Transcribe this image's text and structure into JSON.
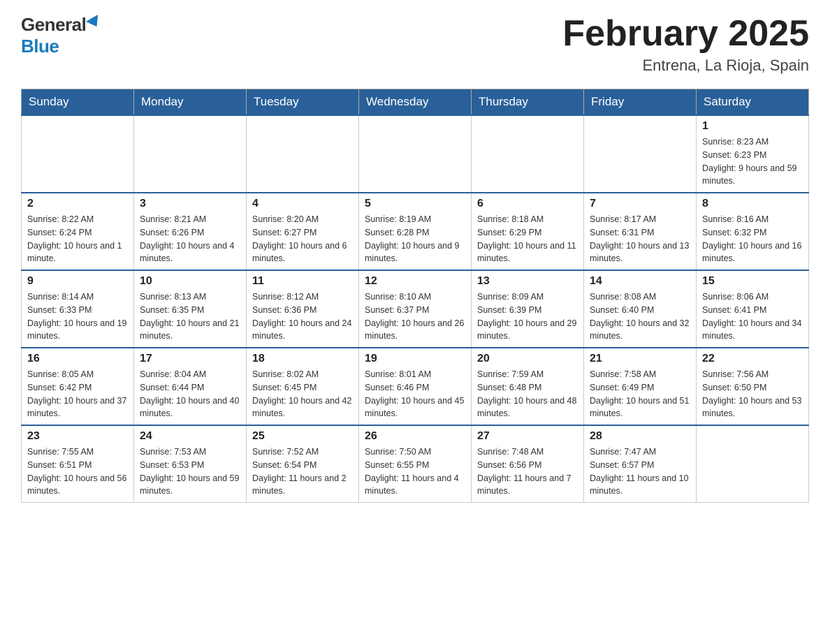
{
  "header": {
    "logo_general": "General",
    "logo_blue": "Blue",
    "month_title": "February 2025",
    "location": "Entrena, La Rioja, Spain"
  },
  "days_of_week": [
    "Sunday",
    "Monday",
    "Tuesday",
    "Wednesday",
    "Thursday",
    "Friday",
    "Saturday"
  ],
  "weeks": [
    [
      {
        "day": "",
        "info": ""
      },
      {
        "day": "",
        "info": ""
      },
      {
        "day": "",
        "info": ""
      },
      {
        "day": "",
        "info": ""
      },
      {
        "day": "",
        "info": ""
      },
      {
        "day": "",
        "info": ""
      },
      {
        "day": "1",
        "info": "Sunrise: 8:23 AM\nSunset: 6:23 PM\nDaylight: 9 hours and 59 minutes."
      }
    ],
    [
      {
        "day": "2",
        "info": "Sunrise: 8:22 AM\nSunset: 6:24 PM\nDaylight: 10 hours and 1 minute."
      },
      {
        "day": "3",
        "info": "Sunrise: 8:21 AM\nSunset: 6:26 PM\nDaylight: 10 hours and 4 minutes."
      },
      {
        "day": "4",
        "info": "Sunrise: 8:20 AM\nSunset: 6:27 PM\nDaylight: 10 hours and 6 minutes."
      },
      {
        "day": "5",
        "info": "Sunrise: 8:19 AM\nSunset: 6:28 PM\nDaylight: 10 hours and 9 minutes."
      },
      {
        "day": "6",
        "info": "Sunrise: 8:18 AM\nSunset: 6:29 PM\nDaylight: 10 hours and 11 minutes."
      },
      {
        "day": "7",
        "info": "Sunrise: 8:17 AM\nSunset: 6:31 PM\nDaylight: 10 hours and 13 minutes."
      },
      {
        "day": "8",
        "info": "Sunrise: 8:16 AM\nSunset: 6:32 PM\nDaylight: 10 hours and 16 minutes."
      }
    ],
    [
      {
        "day": "9",
        "info": "Sunrise: 8:14 AM\nSunset: 6:33 PM\nDaylight: 10 hours and 19 minutes."
      },
      {
        "day": "10",
        "info": "Sunrise: 8:13 AM\nSunset: 6:35 PM\nDaylight: 10 hours and 21 minutes."
      },
      {
        "day": "11",
        "info": "Sunrise: 8:12 AM\nSunset: 6:36 PM\nDaylight: 10 hours and 24 minutes."
      },
      {
        "day": "12",
        "info": "Sunrise: 8:10 AM\nSunset: 6:37 PM\nDaylight: 10 hours and 26 minutes."
      },
      {
        "day": "13",
        "info": "Sunrise: 8:09 AM\nSunset: 6:39 PM\nDaylight: 10 hours and 29 minutes."
      },
      {
        "day": "14",
        "info": "Sunrise: 8:08 AM\nSunset: 6:40 PM\nDaylight: 10 hours and 32 minutes."
      },
      {
        "day": "15",
        "info": "Sunrise: 8:06 AM\nSunset: 6:41 PM\nDaylight: 10 hours and 34 minutes."
      }
    ],
    [
      {
        "day": "16",
        "info": "Sunrise: 8:05 AM\nSunset: 6:42 PM\nDaylight: 10 hours and 37 minutes."
      },
      {
        "day": "17",
        "info": "Sunrise: 8:04 AM\nSunset: 6:44 PM\nDaylight: 10 hours and 40 minutes."
      },
      {
        "day": "18",
        "info": "Sunrise: 8:02 AM\nSunset: 6:45 PM\nDaylight: 10 hours and 42 minutes."
      },
      {
        "day": "19",
        "info": "Sunrise: 8:01 AM\nSunset: 6:46 PM\nDaylight: 10 hours and 45 minutes."
      },
      {
        "day": "20",
        "info": "Sunrise: 7:59 AM\nSunset: 6:48 PM\nDaylight: 10 hours and 48 minutes."
      },
      {
        "day": "21",
        "info": "Sunrise: 7:58 AM\nSunset: 6:49 PM\nDaylight: 10 hours and 51 minutes."
      },
      {
        "day": "22",
        "info": "Sunrise: 7:56 AM\nSunset: 6:50 PM\nDaylight: 10 hours and 53 minutes."
      }
    ],
    [
      {
        "day": "23",
        "info": "Sunrise: 7:55 AM\nSunset: 6:51 PM\nDaylight: 10 hours and 56 minutes."
      },
      {
        "day": "24",
        "info": "Sunrise: 7:53 AM\nSunset: 6:53 PM\nDaylight: 10 hours and 59 minutes."
      },
      {
        "day": "25",
        "info": "Sunrise: 7:52 AM\nSunset: 6:54 PM\nDaylight: 11 hours and 2 minutes."
      },
      {
        "day": "26",
        "info": "Sunrise: 7:50 AM\nSunset: 6:55 PM\nDaylight: 11 hours and 4 minutes."
      },
      {
        "day": "27",
        "info": "Sunrise: 7:48 AM\nSunset: 6:56 PM\nDaylight: 11 hours and 7 minutes."
      },
      {
        "day": "28",
        "info": "Sunrise: 7:47 AM\nSunset: 6:57 PM\nDaylight: 11 hours and 10 minutes."
      },
      {
        "day": "",
        "info": ""
      }
    ]
  ]
}
